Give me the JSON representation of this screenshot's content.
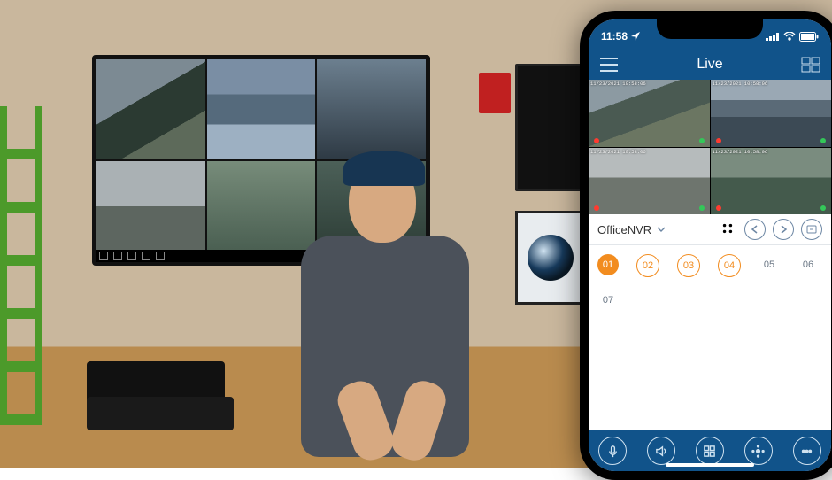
{
  "statusbar": {
    "time": "11:58",
    "location_icon": "location-arrow",
    "signal": "●●●●",
    "wifi": "wifi",
    "battery": "battery"
  },
  "header": {
    "title": "Live",
    "menu_icon": "hamburger",
    "right_icon": "layout-switch"
  },
  "cameras": [
    {
      "timestamp": "11/23/2021 10:58:06"
    },
    {
      "timestamp": "11/23/2021 10:58:06"
    },
    {
      "timestamp": "11/23/2021 10:58:06"
    },
    {
      "timestamp": "11/23/2021 10:58:06"
    }
  ],
  "device": {
    "selected": "OfficeNVR",
    "toolbar": [
      {
        "name": "grid-view-icon"
      },
      {
        "name": "prev-icon"
      },
      {
        "name": "next-icon"
      },
      {
        "name": "stream-quality-icon"
      }
    ]
  },
  "channels": [
    {
      "label": "01",
      "state": "active"
    },
    {
      "label": "02",
      "state": "outline"
    },
    {
      "label": "03",
      "state": "outline"
    },
    {
      "label": "04",
      "state": "outline"
    },
    {
      "label": "05",
      "state": "plain"
    },
    {
      "label": "06",
      "state": "plain"
    },
    {
      "label": "07",
      "state": "plain"
    }
  ],
  "bottombar": [
    {
      "name": "mic-icon"
    },
    {
      "name": "speaker-icon"
    },
    {
      "name": "grid-icon"
    },
    {
      "name": "ptz-icon"
    },
    {
      "name": "more-icon"
    }
  ]
}
